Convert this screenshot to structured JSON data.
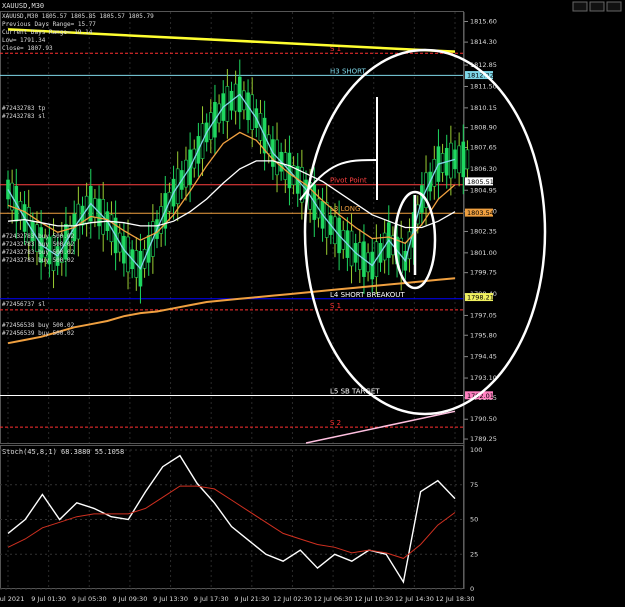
{
  "window": {
    "title": "XAUUSD,M30",
    "controls": [
      "‒",
      "□",
      "×"
    ]
  },
  "info_panel": {
    "symbol_line": "XAUUSD,M30  1805.57 1805.85 1805.57 1805.79",
    "lines": [
      "Previous Days Range= 15.77",
      "Current Days Range= 19.14",
      "Low= 1791.34",
      "Close= 1807.93"
    ]
  },
  "order_labels": [
    "#72432783 tp",
    "#72432783 sl",
    "#72432783 buy 500.02",
    "#72432783 buy 500.02",
    "#72432783 buy 500.02",
    "#72432783 buy 500.02",
    "#72456737 sl",
    "#72456538 buy 500.02",
    "#72456539 buy 500.02"
  ],
  "chart_data": [
    {
      "type": "line",
      "title": "XAUUSD,M30",
      "xlabel": "",
      "ylabel": "",
      "x_ticks": [
        "8 Jul 2021",
        "9 Jul 01:30",
        "9 Jul 05:30",
        "9 Jul 09:30",
        "9 Jul 13:30",
        "9 Jul 17:30",
        "9 Jul 21:30",
        "12 Jul 02:30",
        "12 Jul 06:30",
        "12 Jul 10:30",
        "12 Jul 14:30",
        "12 Jul 18:30"
      ],
      "y_ticks": [
        1815.6,
        1814.3,
        1812.85,
        1811.5,
        1810.15,
        1808.9,
        1807.65,
        1806.3,
        1804.95,
        1803.6,
        1802.35,
        1801.0,
        1799.75,
        1798.4,
        1797.05,
        1795.8,
        1794.45,
        1793.1,
        1791.85,
        1790.5,
        1789.25
      ],
      "ylim": [
        1789.0,
        1816.2
      ],
      "price_tags": [
        {
          "value": 1812.22,
          "label": "1812.22",
          "color": "#7fd7e8"
        },
        {
          "value": 1805.51,
          "label": "1805.51",
          "color": "#ffffff"
        },
        {
          "value": 1803.54,
          "label": "1803.54",
          "color": "#f0a040"
        },
        {
          "value": 1798.21,
          "label": "1798.21",
          "color": "#f0f060"
        },
        {
          "value": 1792.01,
          "label": "1792.01",
          "color": "#ff80c0"
        }
      ],
      "levels": [
        {
          "name": "S 1",
          "value": 1813.6,
          "color": "#ff3030"
        },
        {
          "name": "H3 SHORT",
          "value": 1812.2,
          "color": "#7fd7e8"
        },
        {
          "name": "Pivot Point",
          "value": 1805.3,
          "color": "#ff4040"
        },
        {
          "name": "L3 LONG",
          "value": 1803.5,
          "color": "#f0a040"
        },
        {
          "name": "L4 SHORT BREAKOUT",
          "value": 1798.1,
          "color": "#0000ff"
        },
        {
          "name": "S 1",
          "value": 1797.4,
          "color": "#ff3030"
        },
        {
          "name": "L5 SB TARGET",
          "value": 1792.0,
          "color": "#ffffff"
        },
        {
          "name": "S 2",
          "value": 1790.0,
          "color": "#ff3030"
        }
      ],
      "series": [
        {
          "values": [
            1805.0,
            1803.2,
            1801.5,
            1800.8,
            1802.6,
            1804.1,
            1803.0,
            1801.2,
            1800.0,
            1802.5,
            1804.8,
            1806.4,
            1808.6,
            1810.2,
            1811.0,
            1809.5,
            1807.3,
            1806.2,
            1805.0,
            1803.4,
            1802.1,
            1801.0,
            1800.2,
            1801.8,
            1800.5,
            1804.4,
            1806.6,
            1806.9
          ]
        },
        {
          "values": [
            1804.0,
            1803.6,
            1802.9,
            1802.3,
            1802.6,
            1803.3,
            1803.1,
            1802.4,
            1801.8,
            1802.3,
            1803.4,
            1804.9,
            1806.5,
            1807.9,
            1808.6,
            1808.1,
            1806.9,
            1806.0,
            1805.3,
            1804.3,
            1803.4,
            1802.6,
            1801.9,
            1802.0,
            1801.6,
            1802.8,
            1804.4,
            1805.3
          ]
        },
        {
          "values": [
            1803.0,
            1803.1,
            1802.9,
            1802.7,
            1802.7,
            1802.9,
            1803.0,
            1802.9,
            1802.7,
            1802.7,
            1803.0,
            1803.6,
            1804.4,
            1805.4,
            1806.3,
            1806.8,
            1806.8,
            1806.5,
            1806.0,
            1805.5,
            1804.8,
            1804.1,
            1803.4,
            1803.0,
            1802.6,
            1802.6,
            1803.0,
            1803.6
          ]
        },
        {
          "values": [
            1795.3,
            1795.5,
            1795.7,
            1796.0,
            1796.3,
            1796.5,
            1796.7,
            1797.0,
            1797.2,
            1797.3,
            1797.5,
            1797.7,
            1797.9,
            1798.0,
            1798.1,
            1798.2,
            1798.3,
            1798.4,
            1798.5,
            1798.6,
            1798.7,
            1798.8,
            1798.9,
            1799.0,
            1799.1,
            1799.2,
            1799.3,
            1799.4
          ]
        }
      ],
      "trendlines": [
        {
          "from": [
            1,
            1815.1
          ],
          "to": [
            28,
            1813.7
          ],
          "color": "#ffff30"
        },
        {
          "from": [
            19,
            1789.0
          ],
          "to": [
            28,
            1791.0
          ],
          "color": "#ffc0e0"
        }
      ]
    },
    {
      "type": "line",
      "title": "Stoch(45,8,1) 68.3880 55.1058",
      "y_ticks": [
        100,
        75,
        50,
        25,
        0
      ],
      "ylim": [
        0,
        100
      ],
      "series": [
        {
          "values": [
            40,
            50,
            68,
            50,
            62,
            58,
            52,
            50,
            70,
            88,
            96,
            76,
            62,
            45,
            35,
            25,
            20,
            28,
            15,
            25,
            20,
            28,
            25,
            5,
            70,
            78,
            65
          ]
        },
        {
          "values": [
            30,
            36,
            44,
            48,
            52,
            54,
            54,
            54,
            58,
            66,
            74,
            74,
            72,
            64,
            56,
            48,
            40,
            36,
            32,
            30,
            26,
            28,
            26,
            22,
            32,
            46,
            55
          ]
        }
      ]
    }
  ]
}
